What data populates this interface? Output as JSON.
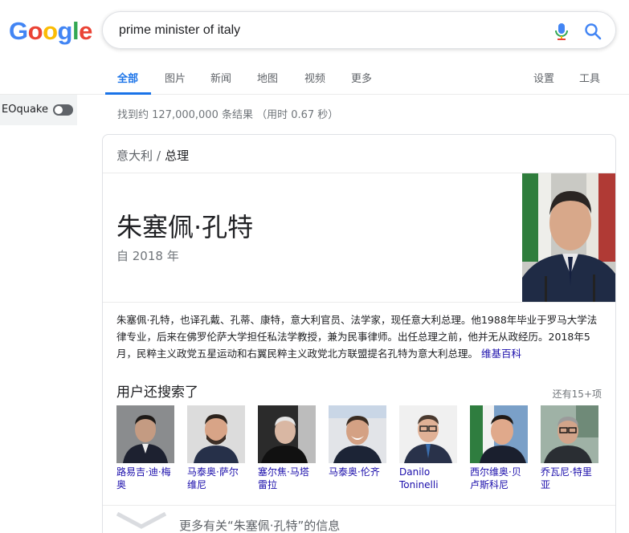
{
  "logo": {
    "letters": [
      {
        "ch": "G",
        "color": "#4285F4"
      },
      {
        "ch": "o",
        "color": "#EA4335"
      },
      {
        "ch": "o",
        "color": "#FBBC05"
      },
      {
        "ch": "g",
        "color": "#4285F4"
      },
      {
        "ch": "l",
        "color": "#34A853"
      },
      {
        "ch": "e",
        "color": "#EA4335"
      }
    ]
  },
  "search": {
    "query": "prime minister of italy"
  },
  "tabs": {
    "all": "全部",
    "images": "图片",
    "news": "新闻",
    "maps": "地图",
    "videos": "视频",
    "more": "更多",
    "settings": "设置",
    "tools": "工具"
  },
  "plugin": {
    "label": "EOquake",
    "enabled": false
  },
  "stats": "找到约 127,000,000 条结果 （用时 0.67 秒）",
  "panel": {
    "breadcrumb": {
      "parent": "意大利",
      "separator": "/",
      "current": "总理"
    },
    "title": "朱塞佩·孔特",
    "subtitle": "自 2018 年",
    "description": "朱塞佩·孔特，也译孔戴、孔蒂、康特，意大利官员、法学家，现任意大利总理。他1988年毕业于罗马大学法律专业，后来在佛罗伦萨大学担任私法学教授，兼为民事律师。出任总理之前，他并无从政经历。2018年5月，民粹主义政党五星运动和右翼民粹主义政党北方联盟提名孔特为意大利总理。",
    "source_link": "维基百科",
    "related_title": "用户还搜索了",
    "related_more": "还有15+项",
    "related": [
      {
        "name": "路易吉·迪·梅奥"
      },
      {
        "name": "马泰奥·萨尔维尼"
      },
      {
        "name": "塞尔焦·马塔雷拉"
      },
      {
        "name": "马泰奥·伦齐"
      },
      {
        "name": "Danilo Toninelli"
      },
      {
        "name": "西尔维奥·贝卢斯科尼"
      },
      {
        "name": "乔瓦尼·特里亚"
      }
    ],
    "more_info": "更多有关“朱塞佩·孔特”的信息"
  }
}
